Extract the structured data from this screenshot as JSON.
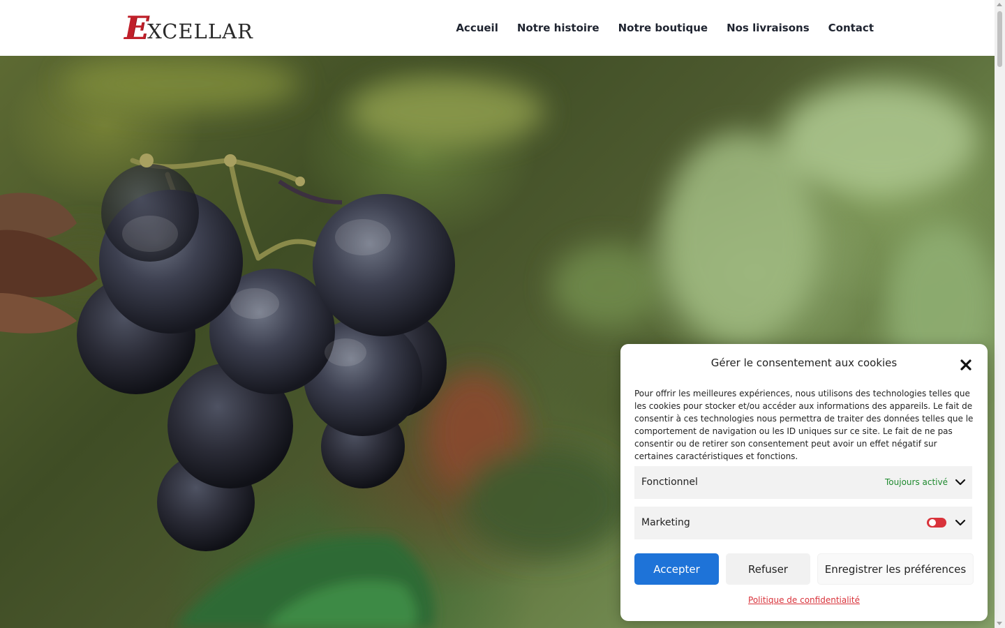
{
  "brand": {
    "logo_initial": "E",
    "logo_rest": "XCELLAR",
    "logo_color": "#c0202a"
  },
  "nav": {
    "items": [
      {
        "label": "Accueil"
      },
      {
        "label": "Notre histoire"
      },
      {
        "label": "Notre boutique"
      },
      {
        "label": "Nos livraisons"
      },
      {
        "label": "Contact"
      }
    ]
  },
  "cookie": {
    "title": "Gérer le consentement aux cookies",
    "description": "Pour offrir les meilleures expériences, nous utilisons des technologies telles que les cookies pour stocker et/ou accéder aux informations des appareils. Le fait de consentir à ces technologies nous permettra de traiter des données telles que le comportement de navigation ou les ID uniques sur ce site. Le fait de ne pas consentir ou de retirer son consentement peut avoir un effet négatif sur certaines caractéristiques et fonctions.",
    "categories": [
      {
        "label": "Fonctionnel",
        "status": "Toujours activé"
      },
      {
        "label": "Marketing",
        "enabled": false
      }
    ],
    "buttons": {
      "accept": "Accepter",
      "refuse": "Refuser",
      "save": "Enregistrer les préférences"
    },
    "policy_link": "Politique de confidentialité",
    "colors": {
      "accept_bg": "#1e73d8",
      "status_green": "#1e8a2e",
      "toggle_off_red": "#d9333b"
    },
    "icons": {
      "close": "close-icon",
      "expand": "chevron-down-icon"
    }
  },
  "hero": {
    "image": "grape-cluster-photo"
  }
}
